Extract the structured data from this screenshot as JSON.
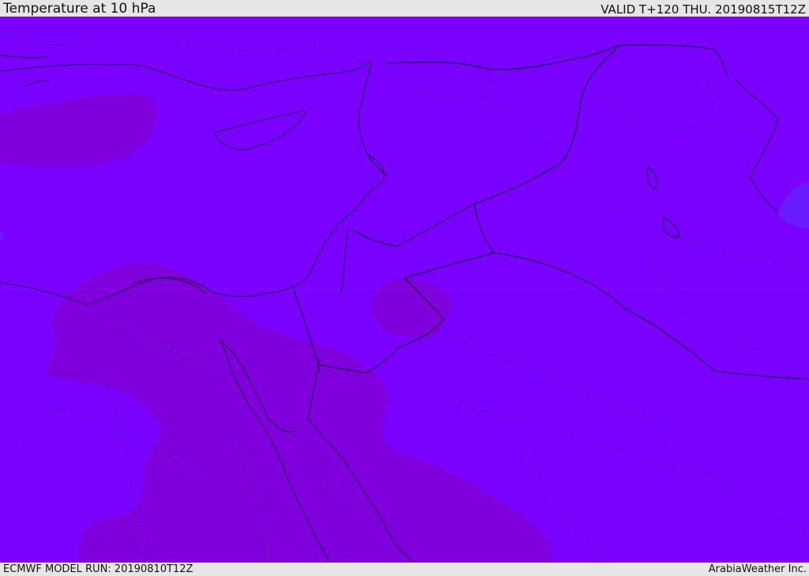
{
  "header": {
    "title": "Temperature at 10 hPa",
    "valid": "VALID T+120 THU. 20190815T12Z"
  },
  "footer": {
    "model_run": "ECMWF MODEL RUN: 20190810T12Z",
    "credit": "ArabiaWeather Inc."
  },
  "colors": {
    "base_field": "#7a00ff",
    "cooler_field": "#7f00dc",
    "warmer_field": "#6a1cff",
    "coastline": "#1a0040",
    "border": "#12002e"
  },
  "map": {
    "variable": "Temperature",
    "level": "10 hPa",
    "region": "Eastern Mediterranean / Middle East"
  }
}
